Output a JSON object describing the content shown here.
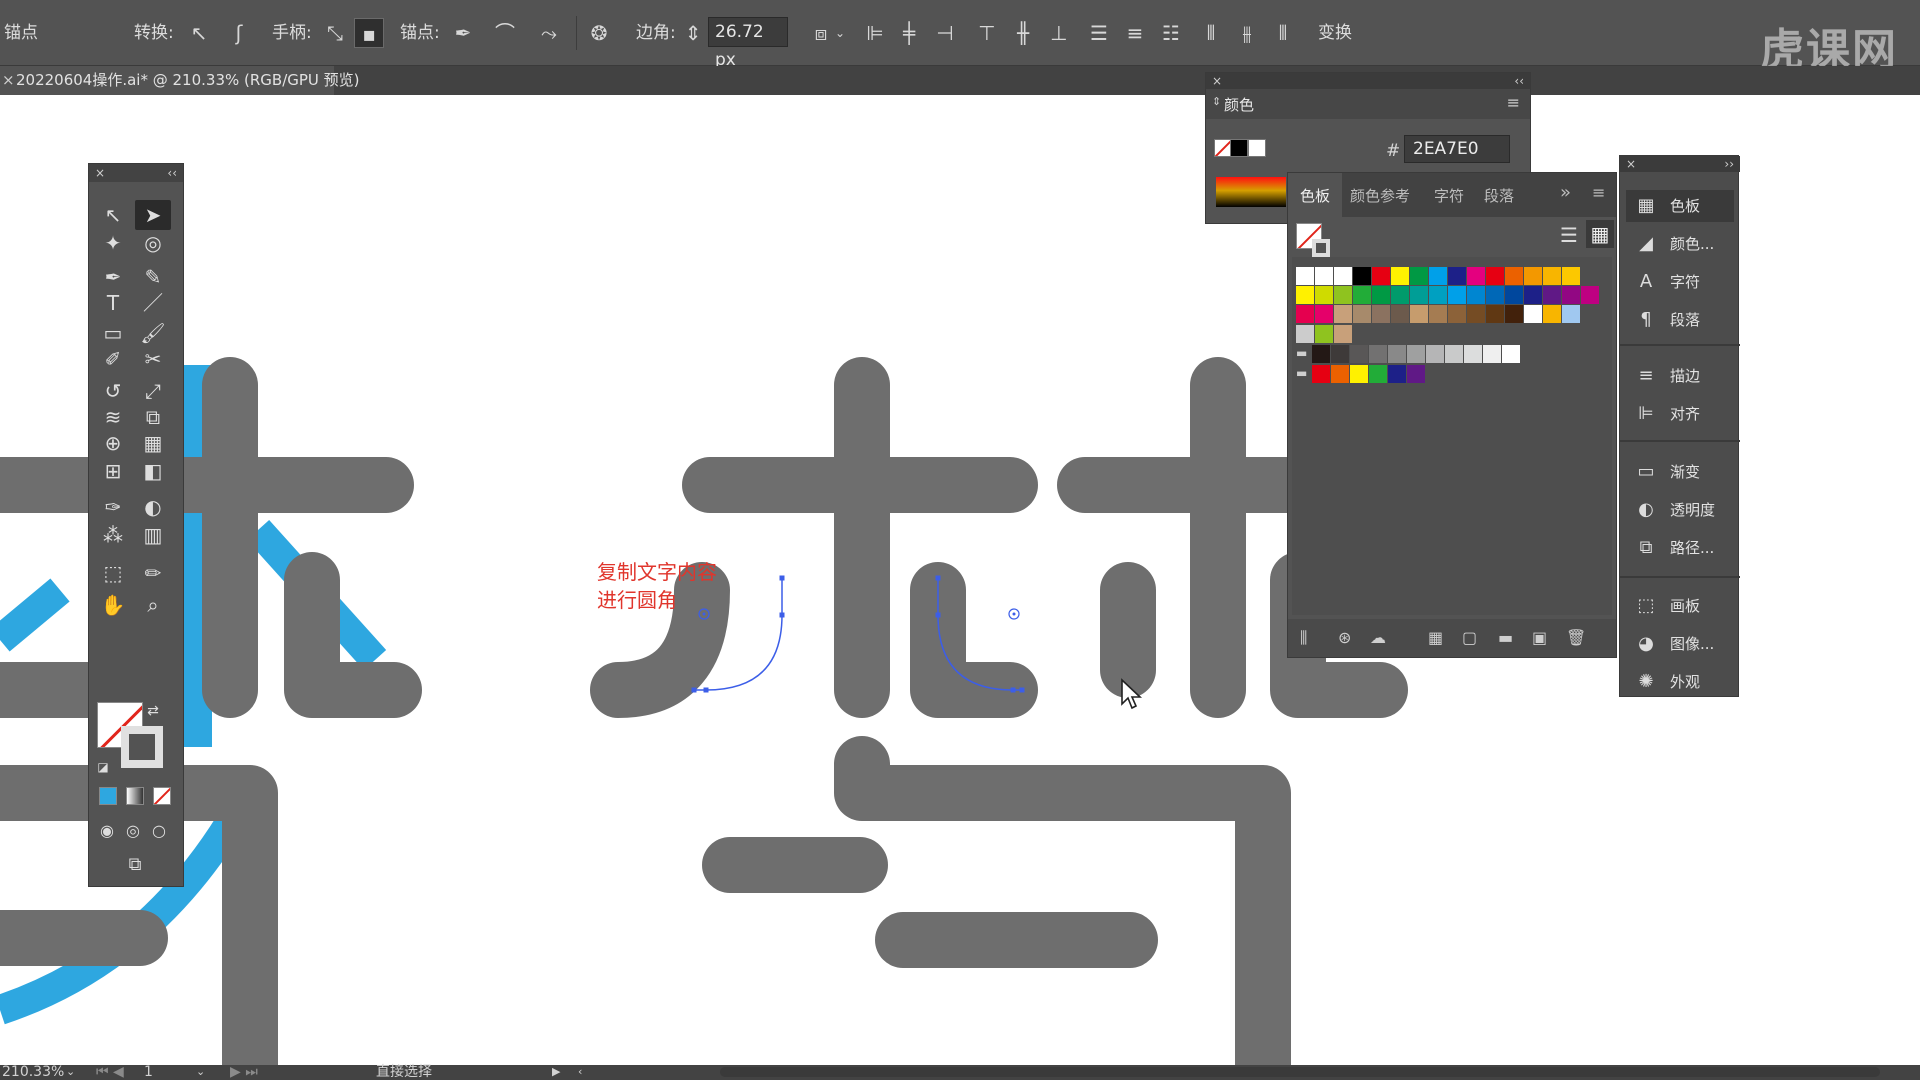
{
  "control_bar": {
    "tool_label": "锚点",
    "convert_label": "转换:",
    "handles_label": "手柄:",
    "anchors_label": "锚点:",
    "corner_label": "边角:",
    "corner_value": "26.72 px",
    "transform_label": "变换",
    "watermark": "虎课网"
  },
  "document": {
    "tab_title": "20220604操作.ai* @ 210.33% (RGB/GPU 预览)",
    "tab_close": "×"
  },
  "annotation": {
    "line1": "复制文字内容",
    "line2": "进行圆角"
  },
  "tools_panel": {
    "close": "×",
    "collapse": "‹‹",
    "tools": [
      {
        "name": "selection",
        "glyph": "↖"
      },
      {
        "name": "direct-selection",
        "glyph": "➤"
      },
      {
        "name": "magic-wand",
        "glyph": "✦"
      },
      {
        "name": "lasso",
        "glyph": "◎"
      },
      {
        "name": "pen",
        "glyph": "✒"
      },
      {
        "name": "curvature",
        "glyph": "✎"
      },
      {
        "name": "type",
        "glyph": "T"
      },
      {
        "name": "line-segment",
        "glyph": "／"
      },
      {
        "name": "rectangle",
        "glyph": "▭"
      },
      {
        "name": "paintbrush",
        "glyph": "🖌"
      },
      {
        "name": "shaper",
        "glyph": "✐"
      },
      {
        "name": "scissors",
        "glyph": "✂"
      },
      {
        "name": "rotate",
        "glyph": "↺"
      },
      {
        "name": "scale",
        "glyph": "⤢"
      },
      {
        "name": "warp",
        "glyph": "≋"
      },
      {
        "name": "free-transform",
        "glyph": "⧉"
      },
      {
        "name": "shape-builder",
        "glyph": "⊕"
      },
      {
        "name": "perspective-grid",
        "glyph": "▦"
      },
      {
        "name": "mesh",
        "glyph": "⊞"
      },
      {
        "name": "gradient",
        "glyph": "◧"
      },
      {
        "name": "eyedropper",
        "glyph": "✑"
      },
      {
        "name": "blend",
        "glyph": "◐"
      },
      {
        "name": "symbol-sprayer",
        "glyph": "⁂"
      },
      {
        "name": "column-graph",
        "glyph": "▥"
      },
      {
        "name": "artboard",
        "glyph": "⬚"
      },
      {
        "name": "slice",
        "glyph": "✏"
      },
      {
        "name": "hand",
        "glyph": "✋"
      },
      {
        "name": "zoom",
        "glyph": "⌕"
      }
    ]
  },
  "color_panel": {
    "close": "×",
    "collapse": "‹‹",
    "title": "颜色",
    "hex_label": "#",
    "hex_value": "2EA7E0"
  },
  "swatches_panel": {
    "tabs": [
      "色板",
      "颜色参考",
      "字符",
      "段落"
    ],
    "overflow": "»",
    "menu": "≡",
    "rows": [
      [
        "#ffffff",
        "#ffffff",
        "#ffffff",
        "#000000",
        "#e60012",
        "#fff100",
        "#009944",
        "#00a0e9",
        "#1d2088",
        "#e4007f",
        "#e60012",
        "#eb6100",
        "#f39800",
        "#f8b500",
        "#fcc800"
      ],
      [
        "#fff100",
        "#cfdb00",
        "#8fc31f",
        "#22ac38",
        "#009944",
        "#009b6b",
        "#009e96",
        "#00a0c1",
        "#00a0e9",
        "#0086d1",
        "#0068b7",
        "#00479d",
        "#1d2088",
        "#601986",
        "#920783",
        "#be0081"
      ],
      [
        "#e5004f",
        "#e5006a",
        "#c8a07a",
        "#a78a6b",
        "#8b7260",
        "#6c5a4c",
        "#c69c6d",
        "#a57c52",
        "#8c6239",
        "#754c24",
        "#603813",
        "#42210b",
        "#ffffff",
        "#f8b500",
        "#a0c8f0"
      ],
      [
        "#cccccc",
        "#8fc31f",
        "#c8a07a"
      ],
      [
        "#231815",
        "#3e3a39",
        "#595757",
        "#727171",
        "#898989",
        "#9fa0a0",
        "#b5b5b6",
        "#c9caca",
        "#dcdddd",
        "#efefef",
        "#ffffff"
      ],
      [
        "#e60012",
        "#eb6100",
        "#fff100",
        "#22ac38",
        "#1d2088",
        "#601986"
      ]
    ]
  },
  "dock": {
    "items": [
      {
        "icon": "swatches-icon",
        "glyph": "▦",
        "label": "色板"
      },
      {
        "icon": "color-icon",
        "glyph": "◢",
        "label": "颜色..."
      },
      {
        "icon": "character-icon",
        "glyph": "A",
        "label": "字符"
      },
      {
        "icon": "paragraph-icon",
        "glyph": "¶",
        "label": "段落"
      },
      {
        "icon": "stroke-icon",
        "glyph": "≡",
        "label": "描边"
      },
      {
        "icon": "align-icon",
        "glyph": "⊫",
        "label": "对齐"
      },
      {
        "icon": "gradient-icon",
        "glyph": "▭",
        "label": "渐变"
      },
      {
        "icon": "transparency-icon",
        "glyph": "◐",
        "label": "透明度"
      },
      {
        "icon": "pathfinder-icon",
        "glyph": "⧉",
        "label": "路径..."
      },
      {
        "icon": "artboards-icon",
        "glyph": "⬚",
        "label": "画板"
      },
      {
        "icon": "image-trace-icon",
        "glyph": "◕",
        "label": "图像..."
      },
      {
        "icon": "appearance-icon",
        "glyph": "✺",
        "label": "外观"
      }
    ]
  },
  "status_bar": {
    "zoom": "210.33%",
    "artboard_number": "1",
    "tool_name": "直接选择"
  },
  "colors": {
    "glyph_gray": "#6e6e6e",
    "accent_blue": "#2ea7e0",
    "path_blue": "#3c5ee8",
    "annotation_red": "#e0352c"
  }
}
